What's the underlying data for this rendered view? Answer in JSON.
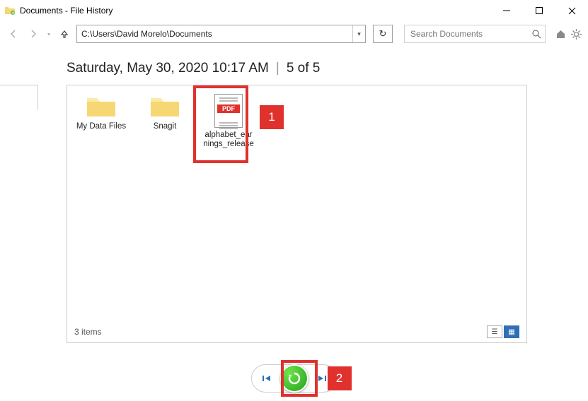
{
  "window": {
    "title": "Documents - File History"
  },
  "toolbar": {
    "path": "C:\\Users\\David Morelo\\Documents",
    "search_placeholder": "Search Documents"
  },
  "header": {
    "timestamp": "Saturday, May 30, 2020 10:17 AM",
    "separator": "|",
    "position": "5 of 5"
  },
  "items": [
    {
      "kind": "folder",
      "label": "My Data Files"
    },
    {
      "kind": "folder",
      "label": "Snagit"
    },
    {
      "kind": "pdf",
      "label": "alphabet_earnings_release",
      "badge": "PDF"
    }
  ],
  "status": {
    "count": "3 items"
  },
  "annotations": {
    "one": "1",
    "two": "2"
  }
}
